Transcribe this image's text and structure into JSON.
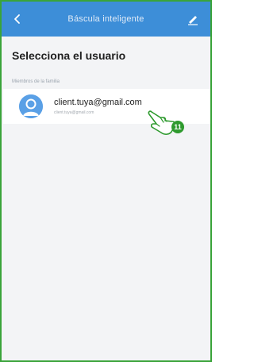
{
  "header": {
    "title": "Báscula inteligente",
    "back_icon": "chevron-left-icon",
    "edit_icon": "pencil-icon"
  },
  "page": {
    "title": "Selecciona el usuario",
    "section_label": "Miembros de la familia"
  },
  "users": [
    {
      "name": "client.tuya@gmail.com",
      "subtitle": "client.tuya@gmail.com"
    }
  ],
  "annotation": {
    "step_number": "11",
    "cursor_icon": "hand-pointer-icon"
  },
  "colors": {
    "header_bg": "#3d8ed8",
    "frame_border": "#3aa43a",
    "avatar": "#5aa0e6",
    "badge": "#2e9a2e",
    "page_bg": "#f3f4f6"
  }
}
